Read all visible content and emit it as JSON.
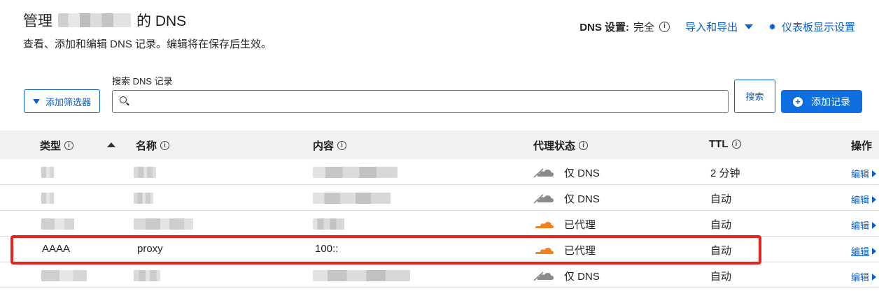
{
  "header": {
    "title_prefix": "管理",
    "title_suffix": "的 DNS",
    "subtitle": "查看、添加和编辑 DNS 记录。编辑将在保存后生效。"
  },
  "top_right": {
    "dns_setting_label": "DNS 设置:",
    "dns_setting_value": "完全",
    "import_export_label": "导入和导出",
    "dashboard_settings_label": "仪表板显示设置"
  },
  "toolbar": {
    "filter_label": "添加筛选器",
    "search_label": "搜索 DNS 记录",
    "search_value": "",
    "search_button_label": "搜索",
    "add_record_label": "添加记录"
  },
  "table": {
    "columns": [
      "类型",
      "名称",
      "内容",
      "代理状态",
      "TTL",
      "操作"
    ],
    "rows": [
      {
        "type": "",
        "name": "",
        "content": "",
        "proxy_status": "仅 DNS",
        "proxied": false,
        "ttl": "2 分钟",
        "action": "编辑"
      },
      {
        "type": "",
        "name": "",
        "content": "",
        "proxy_status": "仅 DNS",
        "proxied": false,
        "ttl": "自动",
        "action": "编辑"
      },
      {
        "type": "",
        "name": "",
        "content": "",
        "proxy_status": "已代理",
        "proxied": true,
        "ttl": "自动",
        "action": "编辑"
      },
      {
        "type": "AAAA",
        "name": "proxy",
        "content": "100::",
        "proxy_status": "已代理",
        "proxied": true,
        "ttl": "自动",
        "action": "编辑"
      },
      {
        "type": "",
        "name": "",
        "content": "",
        "proxy_status": "仅 DNS",
        "proxied": false,
        "ttl": "自动",
        "action": "编辑"
      }
    ]
  },
  "colors": {
    "accent": "#0a5fcc",
    "primary_button": "#0d6fe0",
    "proxied_cloud": "#f38020",
    "dns_only_cloud": "#8a8a8a",
    "highlight_border": "#e8231f"
  }
}
